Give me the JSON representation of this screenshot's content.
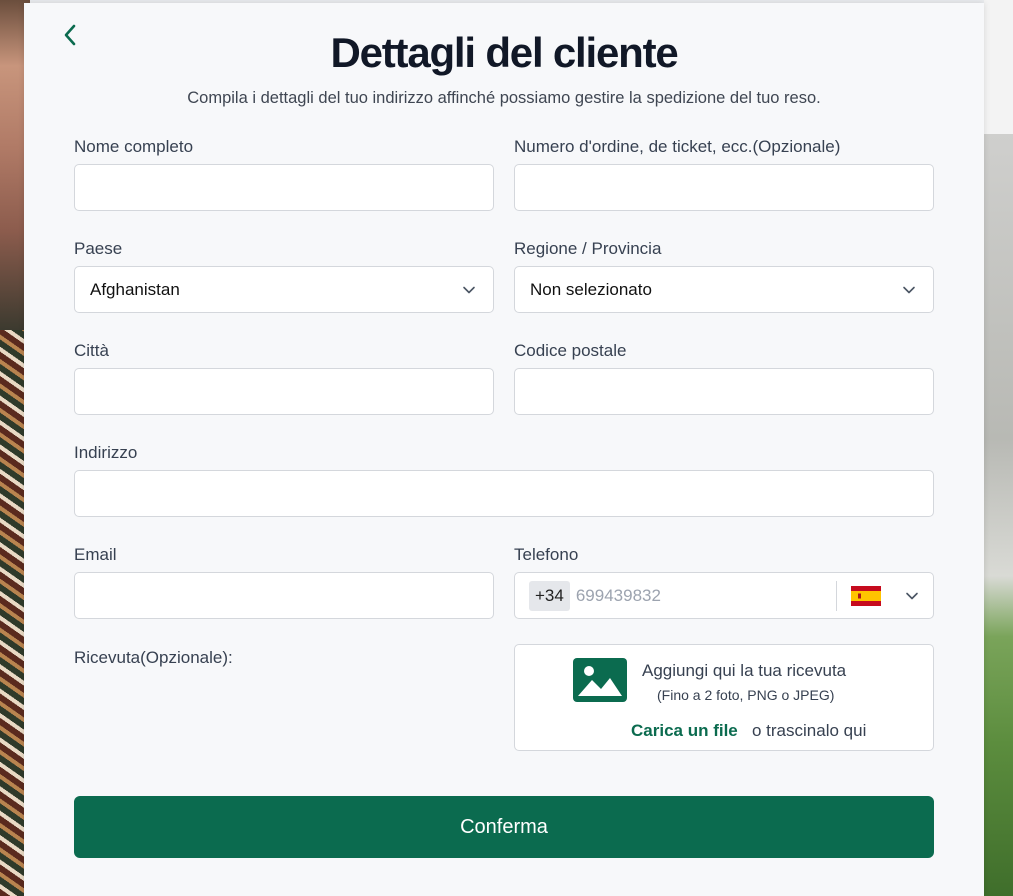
{
  "header": {
    "title": "Dettagli del cliente",
    "subtitle": "Compila i dettagli del tuo indirizzo affinché possiamo gestire la spedizione del tuo reso."
  },
  "form": {
    "full_name": {
      "label": "Nome completo",
      "value": ""
    },
    "order_number": {
      "label": "Numero d'ordine, de ticket, ecc.(Opzionale)",
      "value": ""
    },
    "country": {
      "label": "Paese",
      "selected": "Afghanistan"
    },
    "region": {
      "label": "Regione / Provincia",
      "selected": "Non selezionato"
    },
    "city": {
      "label": "Città",
      "value": ""
    },
    "postal_code": {
      "label": "Codice postale",
      "value": ""
    },
    "address": {
      "label": "Indirizzo",
      "value": ""
    },
    "email": {
      "label": "Email",
      "value": ""
    },
    "phone": {
      "label": "Telefono",
      "prefix": "+34",
      "placeholder": "699439832",
      "flag": "spain-flag-icon"
    },
    "receipt": {
      "label": "Ricevuta(Opzionale):",
      "title": "Aggiungi qui la tua ricevuta",
      "hint": "(Fino a 2 foto, PNG o JPEG)",
      "upload_link": "Carica un file",
      "drag_text": "o trascinalo qui"
    }
  },
  "actions": {
    "confirm_label": "Conferma"
  },
  "colors": {
    "brand": "#0b6b4f",
    "title": "#111827",
    "card": "#f7f8fa"
  }
}
